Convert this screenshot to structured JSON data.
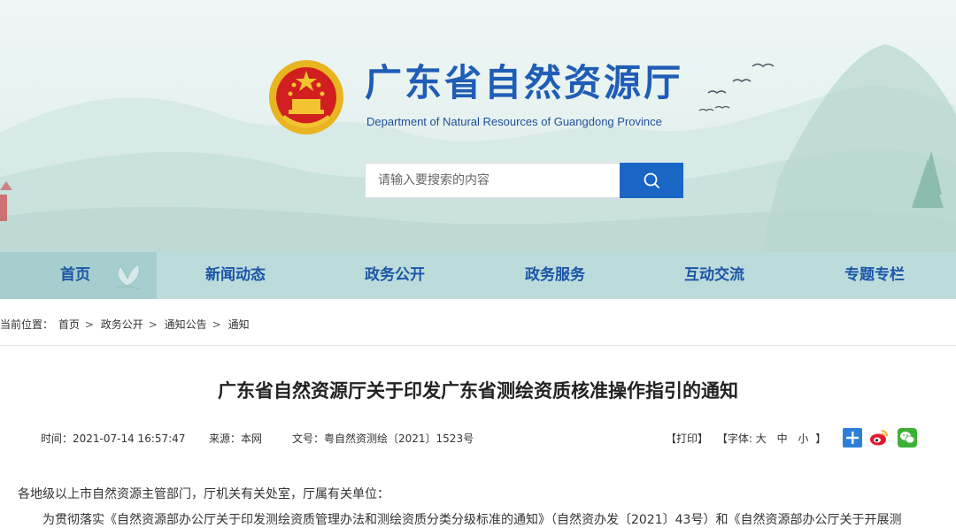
{
  "header": {
    "title": "广东省自然资源厅",
    "subtitle": "Department of Natural Resources of Guangdong Province"
  },
  "search": {
    "placeholder": "请输入要搜索的内容",
    "icon": "search-icon"
  },
  "nav": {
    "items": [
      {
        "label": "首页",
        "active": true
      },
      {
        "label": "新闻动态"
      },
      {
        "label": "政务公开"
      },
      {
        "label": "政务服务"
      },
      {
        "label": "互动交流"
      },
      {
        "label": "专题专栏"
      }
    ]
  },
  "breadcrumb": {
    "prefix": "当前位置：",
    "items": [
      "首页",
      "政务公开",
      "通知公告",
      "通知"
    ],
    "separator": ">"
  },
  "article": {
    "title": "广东省自然资源厅关于印发广东省测绘资质核准操作指引的通知",
    "time": "时间：2021-07-14 16:57:47",
    "source": "来源：本网",
    "doc_no": "文号：粤自然资测绘〔2021〕1523号",
    "print": "【打印】",
    "font_label": "【字体:",
    "font_large": "大",
    "font_medium": "中",
    "font_small": "小",
    "font_close": "】",
    "salutation": "各地级以上市自然资源主管部门，厅机关有关处室，厅属有关单位：",
    "first_line": "为贯彻落实《自然资源部办公厅关于印发测绘资质管理办法和测绘资质分类分级标准的通知》（自然资办发〔2021〕43号）和《自然资源部办公厅关于开展测"
  },
  "share": {
    "icons": [
      "share-plus-icon",
      "weibo-icon",
      "wechat-icon"
    ]
  },
  "colors": {
    "brand_blue": "#1f5db6",
    "search_button": "#1a66c5",
    "nav_background": "#bcdcdc",
    "nav_active": "#a7cece"
  }
}
